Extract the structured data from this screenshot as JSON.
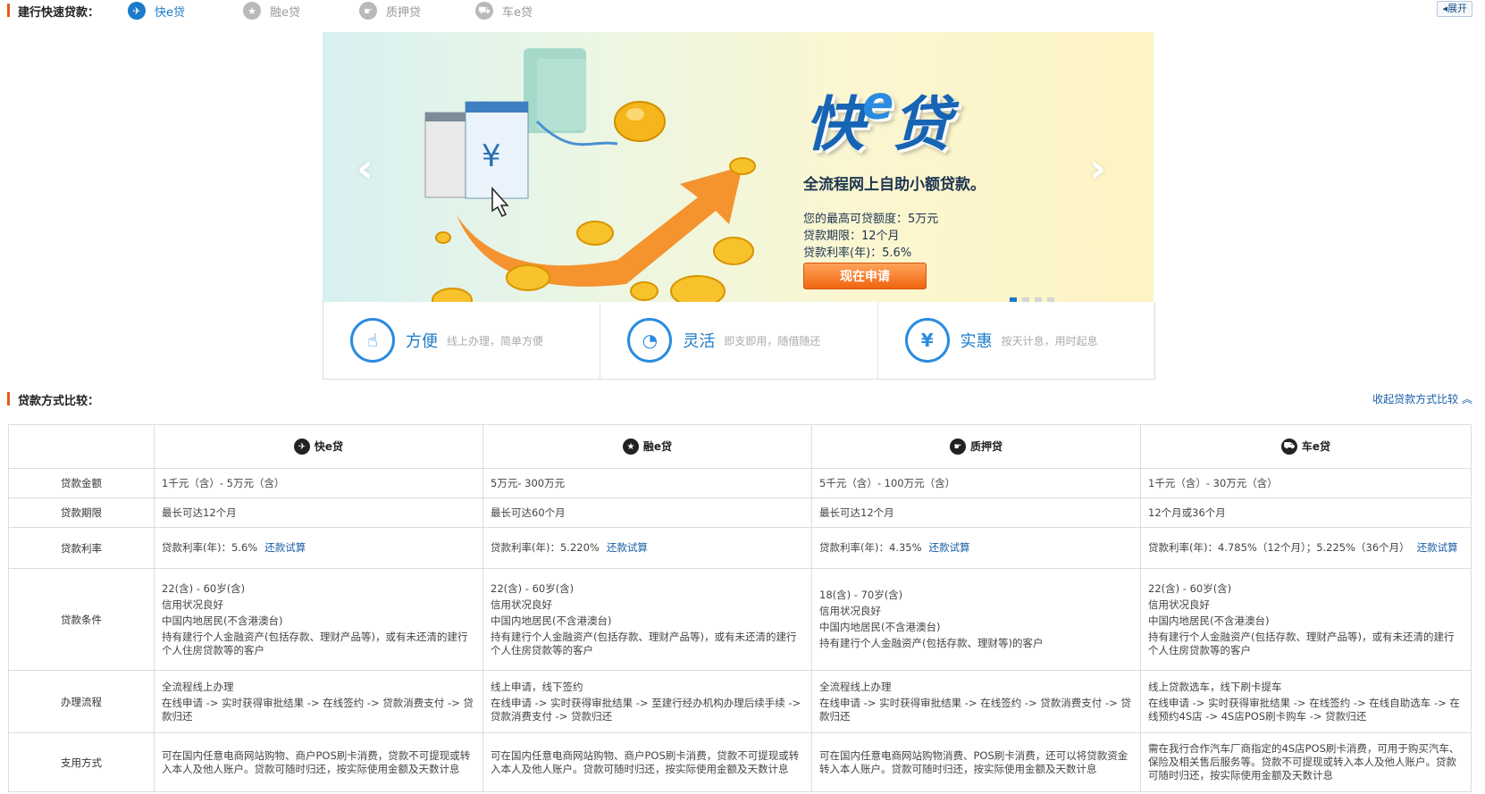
{
  "topnav": {
    "title": "建行快速贷款：",
    "tabs": [
      {
        "label": "快e贷",
        "icon": "plane-icon",
        "glyph": "✈",
        "active": true
      },
      {
        "label": "融e贷",
        "icon": "star-icon",
        "glyph": "★",
        "active": false
      },
      {
        "label": "质押贷",
        "icon": "hand-icon",
        "glyph": "☛",
        "active": false
      },
      {
        "label": "车e贷",
        "icon": "car-icon",
        "glyph": "⛟",
        "active": false
      }
    ],
    "expand_label": "◂展开"
  },
  "banner": {
    "logo": {
      "part1": "快",
      "part2": "e",
      "part3": "贷"
    },
    "tagline": "全流程网上自助小额贷款。",
    "info_lines": [
      "您的最高可贷额度：5万元",
      "贷款期限：12个月",
      "贷款利率(年)：5.6%"
    ],
    "apply_label": "现在申请",
    "prev_glyph": "‹",
    "next_glyph": "›",
    "slides": 4,
    "active_slide": 0
  },
  "features": [
    {
      "name": "方便",
      "desc": "线上办理，简单方便",
      "icon": "touch-icon",
      "glyph": "☝"
    },
    {
      "name": "灵活",
      "desc": "即支即用，随借随还",
      "icon": "gauge-icon",
      "glyph": "◔"
    },
    {
      "name": "实惠",
      "desc": "按天计息，用时起息",
      "icon": "yen-hand-icon",
      "glyph": "¥"
    }
  ],
  "compare": {
    "title": "贷款方式比较：",
    "collapse_label": "收起贷款方式比较 ︽",
    "calc_label": "还款试算",
    "products": [
      {
        "label": "快e贷",
        "icon": "plane-icon",
        "glyph": "✈"
      },
      {
        "label": "融e贷",
        "icon": "star-icon",
        "glyph": "★"
      },
      {
        "label": "质押贷",
        "icon": "hand-icon",
        "glyph": "☛"
      },
      {
        "label": "车e贷",
        "icon": "car-icon",
        "glyph": "⛟"
      }
    ],
    "rows": [
      {
        "label": "贷款金额",
        "cells": [
          [
            "1千元（含）- 5万元（含）"
          ],
          [
            "5万元- 300万元"
          ],
          [
            "5千元（含）- 100万元（含）"
          ],
          [
            "1千元（含）- 30万元（含）"
          ]
        ]
      },
      {
        "label": "贷款期限",
        "cells": [
          [
            "最长可达12个月"
          ],
          [
            "最长可达60个月"
          ],
          [
            "最长可达12个月"
          ],
          [
            "12个月或36个月"
          ]
        ]
      },
      {
        "label": "贷款利率",
        "cells": [
          [
            "贷款利率(年)：5.6%"
          ],
          [
            "贷款利率(年)：5.220%"
          ],
          [
            "贷款利率(年)：4.35%"
          ],
          [
            "贷款利率(年)：4.785%（12个月）；5.225%（36个月）"
          ]
        ]
      },
      {
        "label": "贷款条件",
        "cells": [
          [
            "22(含) - 60岁(含)",
            "信用状况良好",
            "中国内地居民(不含港澳台)",
            "持有建行个人金融资产(包括存款、理财产品等)，或有未还清的建行个人住房贷款等的客户"
          ],
          [
            "22(含) - 60岁(含)",
            "信用状况良好",
            "中国内地居民(不含港澳台)",
            "持有建行个人金融资产(包括存款、理财产品等)，或有未还清的建行个人住房贷款等的客户"
          ],
          [
            "18(含) - 70岁(含)",
            "信用状况良好",
            "中国内地居民(不含港澳台)",
            "持有建行个人金融资产(包括存款、理财等)的客户"
          ],
          [
            "22(含) - 60岁(含)",
            "信用状况良好",
            "中国内地居民(不含港澳台)",
            "持有建行个人金融资产(包括存款、理财产品等)，或有未还清的建行个人住房贷款等的客户"
          ]
        ]
      },
      {
        "label": "办理流程",
        "cells": [
          [
            "全流程线上办理",
            "在线申请 -> 实时获得审批结果 -> 在线签约 -> 贷款消费支付 -> 贷款归还"
          ],
          [
            "线上申请，线下签约",
            "在线申请 -> 实时获得审批结果 -> 至建行经办机构办理后续手续 -> 贷款消费支付 -> 贷款归还"
          ],
          [
            "全流程线上办理",
            "在线申请 -> 实时获得审批结果 -> 在线签约 -> 贷款消费支付 -> 贷款归还"
          ],
          [
            "线上贷款选车，线下刷卡提车",
            "在线申请 -> 实时获得审批结果 -> 在线签约 -> 在线自助选车 -> 在线预约4S店 -> 4S店POS刷卡购车 -> 贷款归还"
          ]
        ]
      },
      {
        "label": "支用方式",
        "cells": [
          [
            "可在国内任意电商网站购物、商户POS刷卡消费，贷款不可提现或转入本人及他人账户。贷款可随时归还，按实际使用金额及天数计息"
          ],
          [
            "可在国内任意电商网站购物、商户POS刷卡消费，贷款不可提现或转入本人及他人账户。贷款可随时归还，按实际使用金额及天数计息"
          ],
          [
            "可在国内任意电商网站购物消费、POS刷卡消费，还可以将贷款资金转入本人账户。贷款可随时归还，按实际使用金额及天数计息"
          ],
          [
            "需在我行合作汽车厂商指定的4S店POS刷卡消费，可用于购买汽车、保险及相关售后服务等。贷款不可提现或转入本人及他人账户。贷款可随时归还，按实际使用金额及天数计息"
          ]
        ]
      }
    ]
  }
}
